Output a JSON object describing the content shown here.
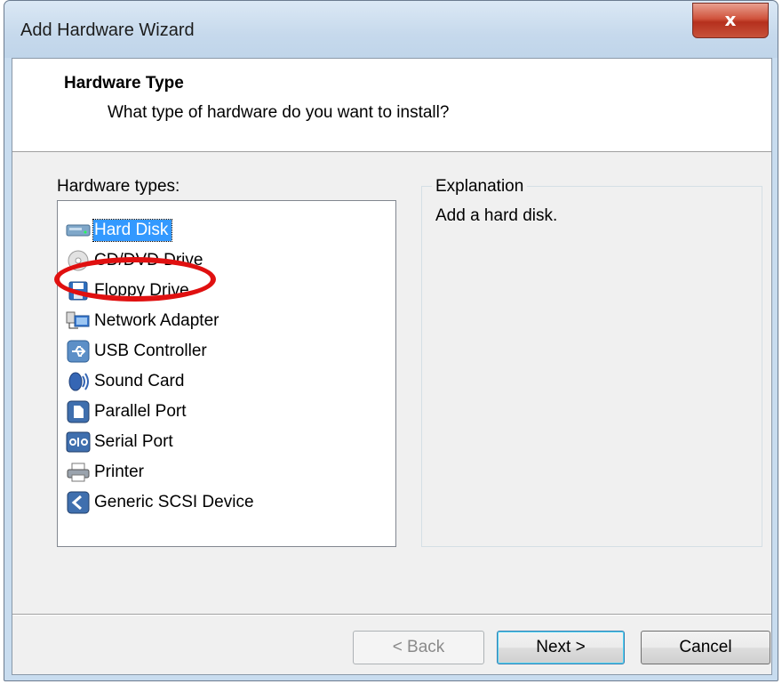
{
  "window": {
    "title": "Add Hardware Wizard",
    "close_glyph": "x"
  },
  "header": {
    "title": "Hardware Type",
    "subtitle": "What type of hardware do you want to install?"
  },
  "hardware_types": {
    "label": "Hardware types:",
    "selected": "Hard Disk",
    "items": [
      {
        "label": "Hard Disk",
        "icon": "hard-disk-icon"
      },
      {
        "label": "CD/DVD Drive",
        "icon": "cd-dvd-icon"
      },
      {
        "label": "Floppy Drive",
        "icon": "floppy-icon"
      },
      {
        "label": "Network Adapter",
        "icon": "network-icon"
      },
      {
        "label": "USB Controller",
        "icon": "usb-icon"
      },
      {
        "label": "Sound Card",
        "icon": "sound-icon"
      },
      {
        "label": "Parallel Port",
        "icon": "parallel-port-icon"
      },
      {
        "label": "Serial Port",
        "icon": "serial-port-icon"
      },
      {
        "label": "Printer",
        "icon": "printer-icon"
      },
      {
        "label": "Generic SCSI Device",
        "icon": "scsi-icon"
      }
    ]
  },
  "explanation": {
    "label": "Explanation",
    "text": "Add a hard disk."
  },
  "buttons": {
    "back": "< Back",
    "next": "Next >",
    "cancel": "Cancel"
  },
  "colors": {
    "selection": "#3399ff",
    "callout": "#e01010",
    "close_button": "#c8523a"
  }
}
